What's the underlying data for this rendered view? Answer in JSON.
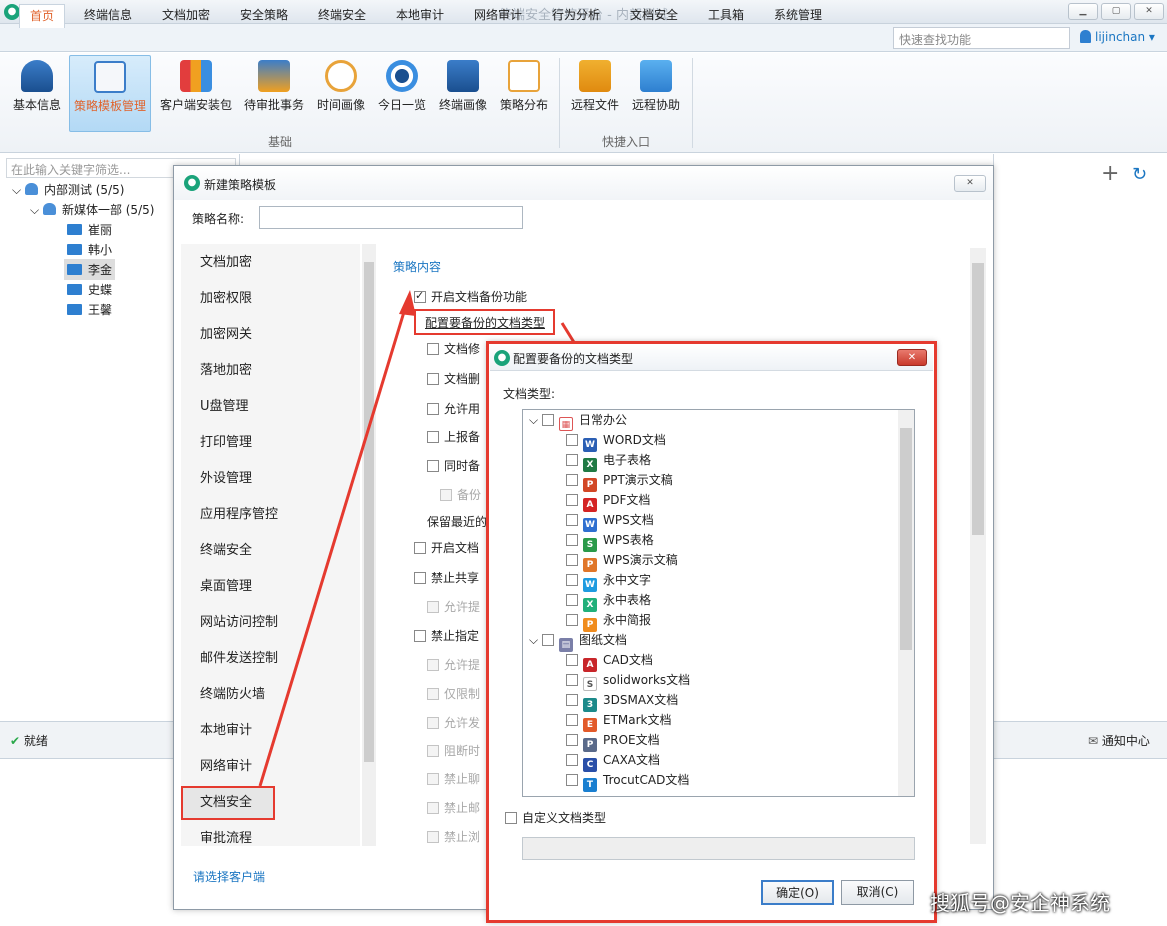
{
  "app": {
    "title": "终端安全管控平台 - 内部测试",
    "logo": "shield-logo"
  },
  "menu": {
    "items": [
      "首页",
      "终端信息",
      "文档加密",
      "安全策略",
      "终端安全",
      "本地审计",
      "网络审计",
      "行为分析",
      "文档安全",
      "工具箱",
      "系统管理"
    ],
    "active": "首页"
  },
  "quick_search": {
    "placeholder": "快速查找功能"
  },
  "user": {
    "name": "lijinchan"
  },
  "ribbon": {
    "buttons": [
      "基本信息",
      "策略模板管理",
      "客户端安装包",
      "待审批事务",
      "时间画像",
      "今日一览",
      "终端画像",
      "策略分布",
      "远程文件",
      "远程协助"
    ],
    "active": "策略模板管理",
    "groups": [
      "基础",
      "快捷入口"
    ]
  },
  "tree": {
    "filter_placeholder": "在此输入关键字筛选...",
    "root": "内部测试 (5/5)",
    "dept": "新媒体一部 (5/5)",
    "users": [
      "崔丽",
      "韩小",
      "李金",
      "史蝶",
      "王馨"
    ],
    "selected": "李金"
  },
  "status": {
    "text": "就绪",
    "notify": "通知中心"
  },
  "dialog": {
    "title": "新建策略模板",
    "name_label": "策略名称:",
    "name_value": "",
    "categories": [
      "文档加密",
      "加密权限",
      "加密网关",
      "落地加密",
      "U盘管理",
      "打印管理",
      "外设管理",
      "应用程序管控",
      "终端安全",
      "桌面管理",
      "网站访问控制",
      "邮件发送控制",
      "终端防火墙",
      "本地审计",
      "网络审计",
      "文档安全",
      "审批流程"
    ],
    "selected_category": "文档安全",
    "client_link": "请选择客户端",
    "section_title": "策略内容",
    "options": {
      "enable_backup": "开启文档备份功能",
      "configure_link": "配置要备份的文档类型",
      "sub1": "文档修",
      "sub2": "文档删",
      "sub3": "允许用",
      "sub4": "上报备",
      "sub5": "同时备",
      "sub6": "备份",
      "keep_recent": "保留最近的",
      "enable_doc": "开启文档",
      "ban_share": "禁止共享",
      "allow_prompt1": "允许提",
      "ban_specified": "禁止指定",
      "allow_prompt2": "允许提",
      "only_restrict": "仅限制",
      "allow_send": "允许发",
      "block_when": "阻断时",
      "ban_chat": "禁止聊",
      "ban_mail": "禁止邮",
      "ban_browse": "禁止浏"
    }
  },
  "subdialog": {
    "title": "配置要备份的文档类型",
    "doc_type_label": "文档类型:",
    "group1": {
      "name": "日常办公",
      "items": [
        "WORD文档",
        "电子表格",
        "PPT演示文稿",
        "PDF文档",
        "WPS文档",
        "WPS表格",
        "WPS演示文稿",
        "永中文字",
        "永中表格",
        "永中简报"
      ]
    },
    "group2": {
      "name": "图纸文档",
      "items": [
        "CAD文档",
        "solidworks文档",
        "3DSMAX文档",
        "ETMark文档",
        "PROE文档",
        "CAXA文档",
        "TrocutCAD文档"
      ]
    },
    "custom_label": "自定义文档类型",
    "ok": "确定(O)",
    "cancel": "取消(C)"
  },
  "watermark": "搜狐号@安企神系统"
}
